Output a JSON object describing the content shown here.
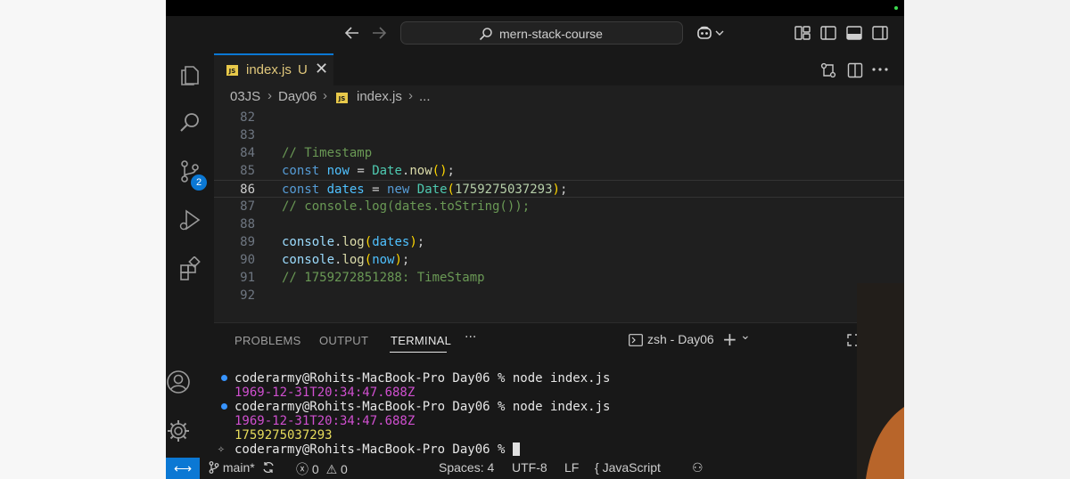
{
  "titlebar": {
    "back_icon": "arrow-left-icon",
    "forward_icon": "arrow-right-icon",
    "search_text": "mern-stack-course",
    "copilot_icon": "copilot-icon"
  },
  "activity_bar": {
    "items": [
      "explorer-icon",
      "search-icon",
      "source-control-icon",
      "run-debug-icon",
      "extensions-icon"
    ],
    "scm_badge": "2",
    "bottom": [
      "account-icon",
      "settings-gear-icon"
    ]
  },
  "tab": {
    "icon_text": "JS",
    "filename": "index.js",
    "status": "U",
    "close": "✕"
  },
  "breadcrumb": {
    "items": [
      "03JS",
      "Day06",
      "index.js",
      "..."
    ],
    "sep": "›"
  },
  "editor": {
    "line_numbers": [
      "82",
      "83",
      "84",
      "85",
      "86",
      "87",
      "88",
      "89",
      "90",
      "91",
      "92"
    ],
    "current_line": "86",
    "lines": {
      "l84": "// Timestamp",
      "l85": {
        "kw": "const",
        "name": "now",
        "eq": " = ",
        "obj": "Date",
        "dot": ".",
        "fn": "now",
        "open": "(",
        "close": ")",
        "semi": ";"
      },
      "l86": {
        "kw": "const",
        "name": "dates",
        "eq": " = ",
        "new": "new",
        "cls": "Date",
        "open": "(",
        "num": "1759275037293",
        "close": ")",
        "semi": ";"
      },
      "l87": "// console.log(dates.toString());",
      "l89": {
        "obj": "console",
        "dot": ".",
        "fn": "log",
        "open": "(",
        "arg": "dates",
        "close": ")",
        "semi": ";"
      },
      "l90": {
        "obj": "console",
        "dot": ".",
        "fn": "log",
        "open": "(",
        "arg": "now",
        "close": ")",
        "semi": ";"
      },
      "l91": "// 1759272851288: TimeStamp"
    }
  },
  "panel": {
    "tabs": [
      "PROBLEMS",
      "OUTPUT",
      "TERMINAL"
    ],
    "active_tab": "TERMINAL",
    "more": "···",
    "terminal_name": "zsh - Day06",
    "add": "+",
    "chevron": "⌄"
  },
  "terminal": {
    "prompt1": "coderarmy@Rohits-MacBook-Pro Day06 % node index.js",
    "out1": "1969-12-31T20:34:47.688Z",
    "prompt2": "coderarmy@Rohits-MacBook-Pro Day06 % node index.js",
    "out2": "1969-12-31T20:34:47.688Z",
    "out3": "1759275037293",
    "prompt3": "coderarmy@Rohits-MacBook-Pro Day06 % "
  },
  "statusbar": {
    "remote": "⟷",
    "branch": "main*",
    "errors": "0",
    "warnings": "0",
    "spaces": "Spaces: 4",
    "encoding": "UTF-8",
    "eol": "LF",
    "language": "JavaScript"
  },
  "colors": {
    "accent": "#0b78d4",
    "comment": "#6a9955",
    "keyword": "#569cd6",
    "date_output": "#cf4fcf",
    "number_output": "#e6dc5c",
    "tab_modified": "#e0c77b"
  }
}
